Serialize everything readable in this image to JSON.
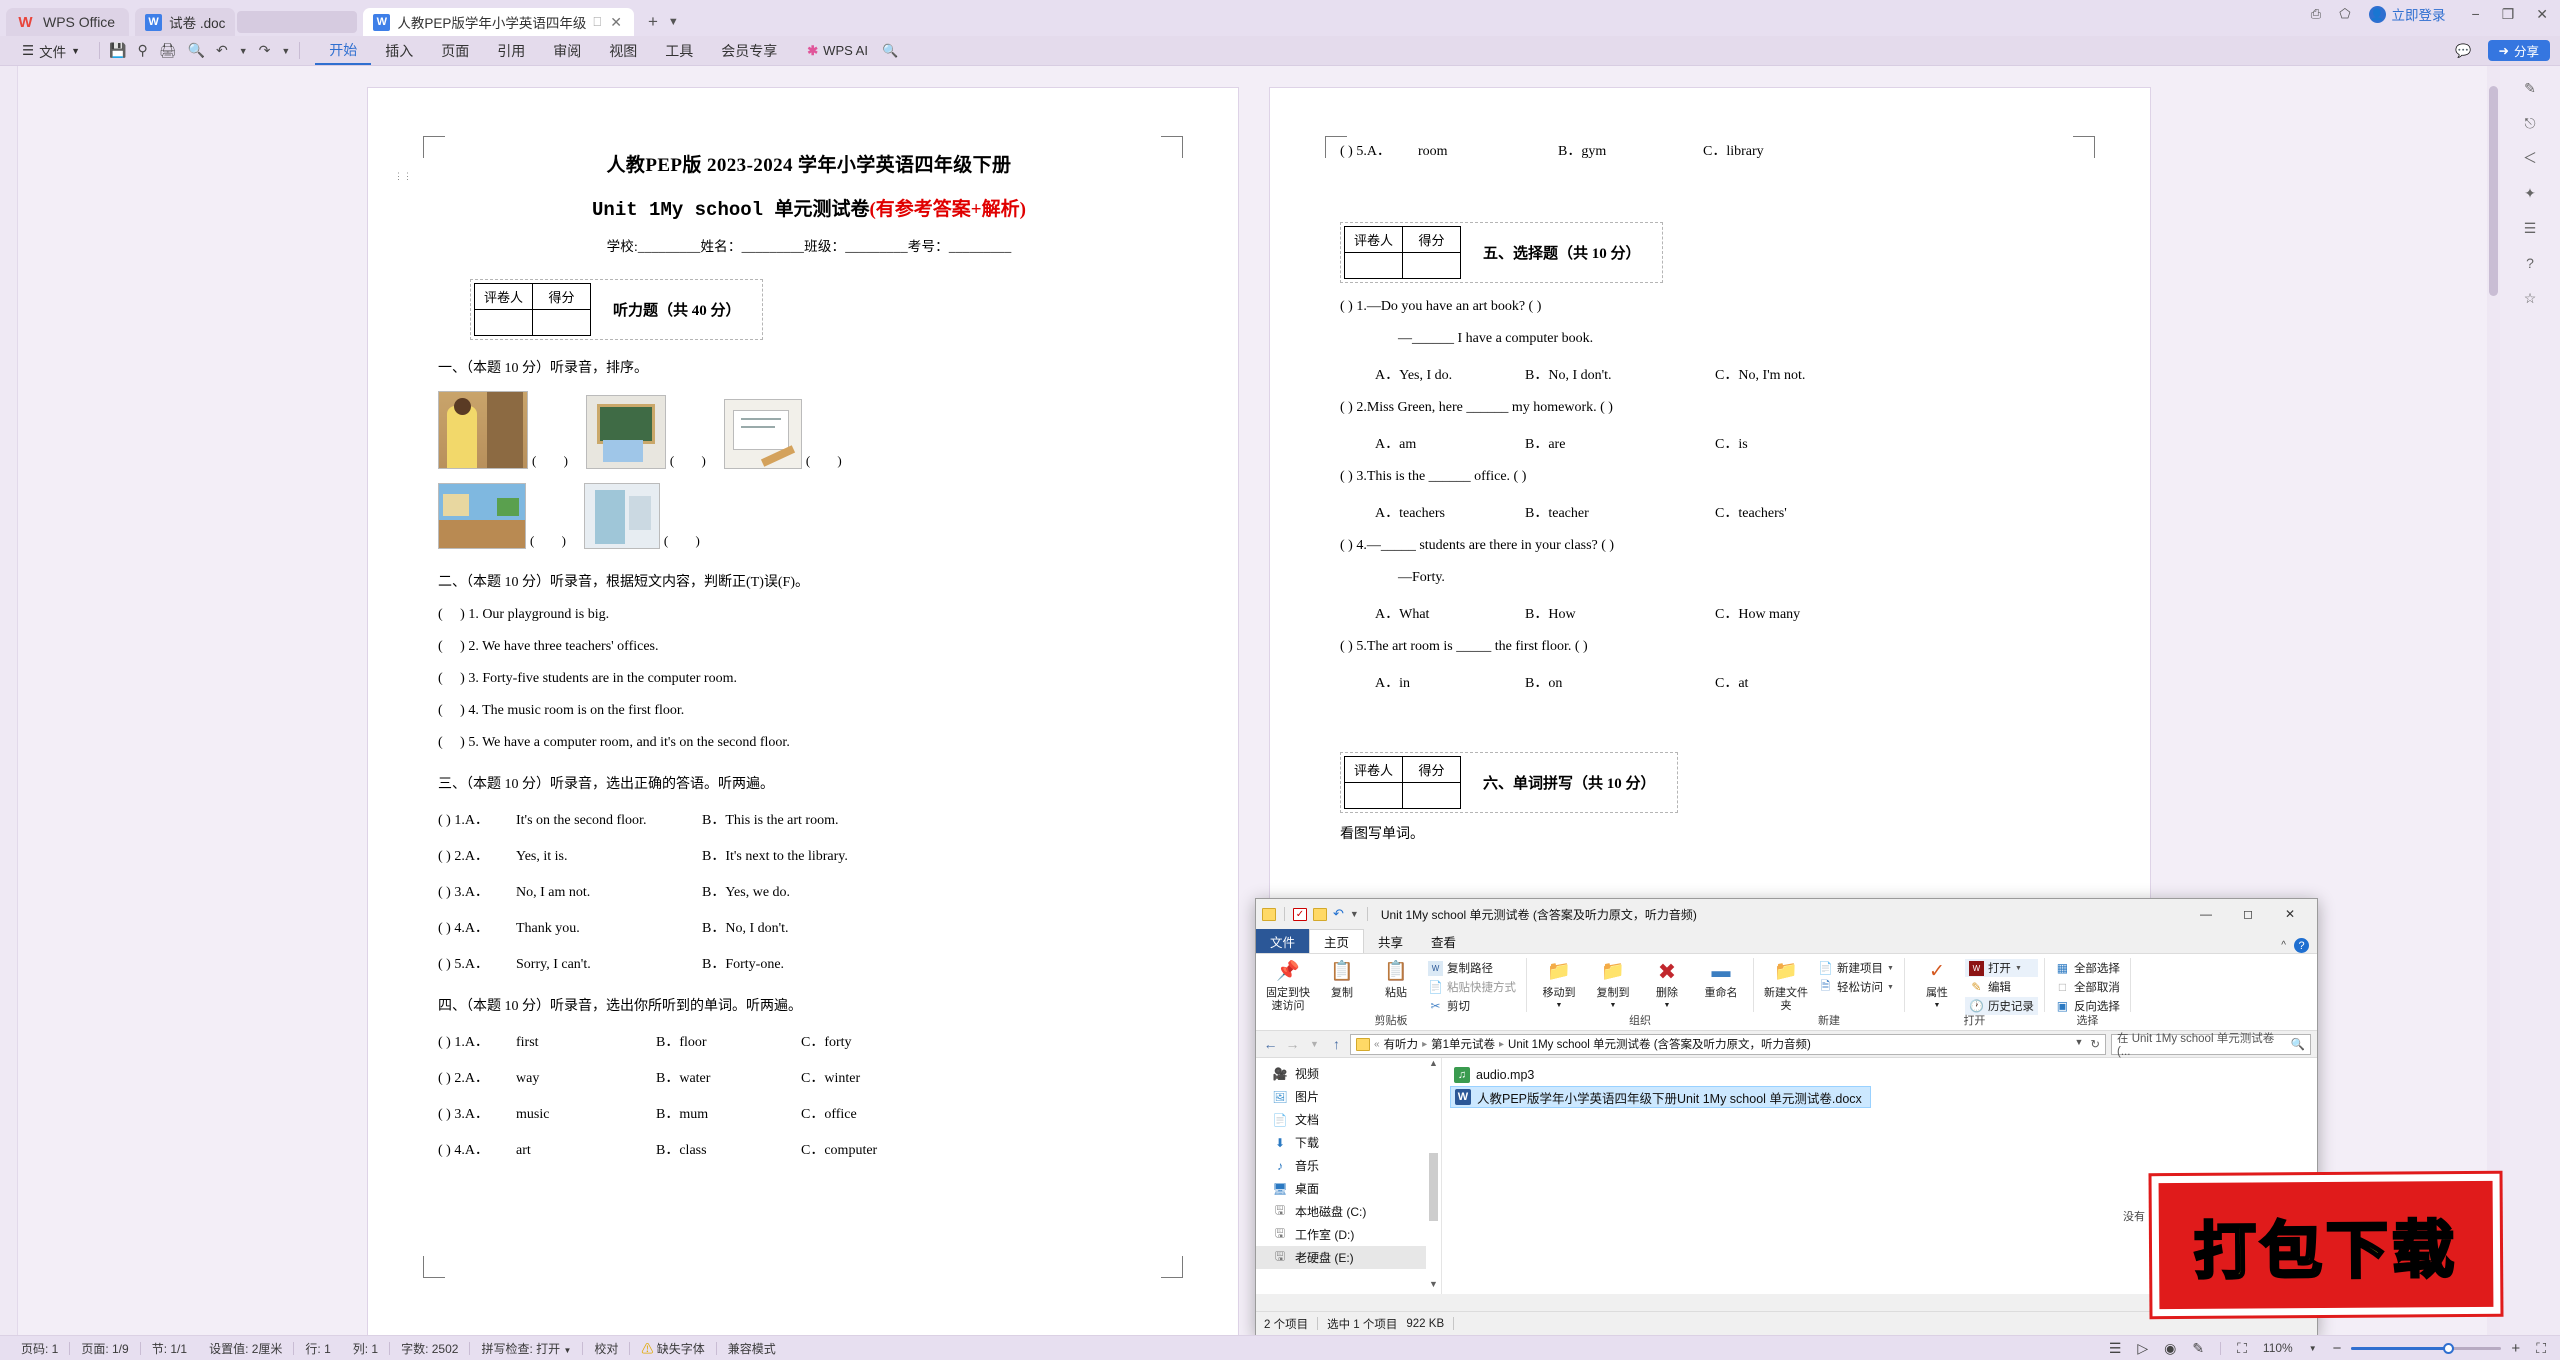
{
  "titlebar": {
    "app_label": "WPS Office",
    "app_icon": "wps-logo-icon",
    "tabs": [
      {
        "label": "试卷 .doc",
        "icon": "word-doc-icon",
        "active": false
      },
      {
        "label": "人教PEP版学年小学英语四年级",
        "icon": "word-doc-icon",
        "active": true
      }
    ],
    "new_tab": "+",
    "login_label": "立即登录",
    "share_label": "分享",
    "minimize": "−",
    "restore": "❐",
    "close": "✕"
  },
  "ribbon": {
    "file_menu": "文件",
    "quick_icons": [
      "save-icon",
      "print-preview-icon",
      "print-icon",
      "find-print-icon",
      "undo-icon",
      "redo-icon"
    ],
    "menu": [
      {
        "label": "开始",
        "active": true
      },
      {
        "label": "插入",
        "active": false
      },
      {
        "label": "页面",
        "active": false
      },
      {
        "label": "引用",
        "active": false
      },
      {
        "label": "审阅",
        "active": false
      },
      {
        "label": "视图",
        "active": false
      },
      {
        "label": "工具",
        "active": false
      },
      {
        "label": "会员专享",
        "active": false
      }
    ],
    "ai_label": "WPS AI",
    "search_icon": "search-icon"
  },
  "document": {
    "title_line1": "人教PEP版 2023-2024 学年小学英语四年级下册",
    "title_line2_black": "Unit 1My school 单元测试卷",
    "title_line2_red": "(有参考答案+解析)",
    "meta_line": "学校:_________姓名：_________班级：_________考号：_________",
    "score_table": {
      "grader": "评卷人",
      "score": "得分"
    },
    "section_listening": "听力题（共 40 分）",
    "q1_head": "一、（本题 10 分）听录音，排序。",
    "q1_blanks": [
      "(        )",
      "(        )",
      "(        )",
      "(        )",
      "(        )"
    ],
    "q2_head": "二、（本题 10 分）听录音，根据短文内容，判断正(T)误(F)。",
    "q2_items": [
      "(     ) 1. Our playground is big.",
      "(     ) 2. We have three teachers' offices.",
      "(     ) 3. Forty-five students are in the computer room.",
      "(     ) 4. The music room is on the first floor.",
      "(     ) 5. We have a computer room, and it's on the second floor."
    ],
    "q3_head": "三、（本题 10 分）听录音，选出正确的答语。听两遍。",
    "q3_items": [
      {
        "num": "(      ) 1.A．",
        "a": "It's on the second floor.",
        "b": "B．This is the art room."
      },
      {
        "num": "(      ) 2.A．",
        "a": "Yes, it is.",
        "b": "B．It's next to the library."
      },
      {
        "num": "(      ) 3.A．",
        "a": "No, I am not.",
        "b": "B．Yes, we do."
      },
      {
        "num": "(      ) 4.A．",
        "a": "Thank you.",
        "b": "B．No, I don't."
      },
      {
        "num": "(      ) 5.A．",
        "a": "Sorry, I can't.",
        "b": "B．Forty-one."
      }
    ],
    "q4_head": "四、（本题 10 分）听录音，选出你所听到的单词。听两遍。",
    "q4_items": [
      {
        "num": "(      ) 1.A．",
        "a": "first",
        "b": "B．floor",
        "c": "C．forty"
      },
      {
        "num": "(      ) 2.A．",
        "a": "way",
        "b": "B．water",
        "c": "C．winter"
      },
      {
        "num": "(      ) 3.A．",
        "a": "music",
        "b": "B．mum",
        "c": "C．office"
      },
      {
        "num": "(      ) 4.A．",
        "a": "art",
        "b": "B．class",
        "c": "C．computer"
      },
      {
        "num": "(      ) 5.A．",
        "a": "room",
        "b": "B．gym",
        "c": "C．library"
      }
    ],
    "section_choice": "五、选择题（共 10 分）",
    "q5_items": [
      {
        "stem": "(     ) 1.—Do you have an art book? (    )",
        "sub": "—______ I have a computer book.",
        "a": "A．Yes, I do.",
        "b": "B．No, I don't.",
        "c": "C．No, I'm not."
      },
      {
        "stem": "(     ) 2.Miss Green, here ______ my homework. (   )",
        "sub": "",
        "a": "A．am",
        "b": "B．are",
        "c": "C．is"
      },
      {
        "stem": "(     ) 3.This is the ______ office. (   )",
        "sub": "",
        "a": "A．teachers",
        "b": "B．teacher",
        "c": "C．teachers'"
      },
      {
        "stem": "(     ) 4.—_____ students are there in your class? (   )",
        "sub": "—Forty.",
        "a": "A．What",
        "b": "B．How",
        "c": "C．How many"
      },
      {
        "stem": "(     ) 5.The art room is _____ the first floor. (   )",
        "sub": "",
        "a": "A．in",
        "b": "B．on",
        "c": "C．at"
      }
    ],
    "section_spelling": "六、单词拼写（共 10 分）",
    "q6_head": "看图写单词。"
  },
  "explorer": {
    "window_title": "Unit 1My school 单元测试卷 (含答案及听力原文，听力音频)",
    "quick_icons": [
      "folder-icon",
      "properties-icon",
      "new-folder-icon",
      "undo-icon",
      "customize-icon"
    ],
    "tabs": [
      "文件",
      "主页",
      "共享",
      "查看"
    ],
    "help_icon": "help-icon",
    "collapse_icon": "chevron-up-icon",
    "ribbon_groups": [
      {
        "name": "剪贴板",
        "big": [
          {
            "label": "固定到快速访问",
            "icon": "pin-icon"
          },
          {
            "label": "复制",
            "icon": "copy-icon"
          },
          {
            "label": "粘贴",
            "icon": "paste-icon"
          }
        ],
        "small": [
          {
            "label": "复制路径",
            "icon": "copy-path-icon"
          },
          {
            "label": "粘贴快捷方式",
            "icon": "paste-shortcut-icon"
          },
          {
            "label": "剪切",
            "icon": "scissors-icon"
          }
        ]
      },
      {
        "name": "组织",
        "big": [
          {
            "label": "移动到",
            "icon": "move-to-icon"
          },
          {
            "label": "复制到",
            "icon": "copy-to-icon"
          },
          {
            "label": "删除",
            "icon": "delete-icon"
          },
          {
            "label": "重命名",
            "icon": "rename-icon"
          }
        ],
        "small": []
      },
      {
        "name": "新建",
        "big": [
          {
            "label": "新建文件夹",
            "icon": "new-folder-icon"
          }
        ],
        "small": [
          {
            "label": "新建项目",
            "icon": "new-item-icon"
          },
          {
            "label": "轻松访问",
            "icon": "easy-access-icon"
          }
        ]
      },
      {
        "name": "打开",
        "big": [
          {
            "label": "属性",
            "icon": "properties-icon"
          }
        ],
        "small": [
          {
            "label": "打开",
            "icon": "wps-open-icon"
          },
          {
            "label": "编辑",
            "icon": "edit-icon"
          },
          {
            "label": "历史记录",
            "icon": "history-icon"
          }
        ]
      },
      {
        "name": "选择",
        "big": [],
        "small": [
          {
            "label": "全部选择",
            "icon": "select-all-icon"
          },
          {
            "label": "全部取消",
            "icon": "select-none-icon"
          },
          {
            "label": "反向选择",
            "icon": "invert-selection-icon"
          }
        ]
      }
    ],
    "address": {
      "crumbs": [
        "有听力",
        "第1单元试卷",
        "Unit 1My school 单元测试卷 (含答案及听力原文，听力音频)"
      ],
      "refresh_icon": "refresh-icon",
      "dropdown_icon": "chevron-down-icon"
    },
    "search_placeholder": "在 Unit 1My school 单元测试卷 (...",
    "nav_items": [
      {
        "label": "视频",
        "icon": "video-icon"
      },
      {
        "label": "图片",
        "icon": "picture-icon"
      },
      {
        "label": "文档",
        "icon": "documents-icon"
      },
      {
        "label": "下载",
        "icon": "download-icon"
      },
      {
        "label": "音乐",
        "icon": "music-icon"
      },
      {
        "label": "桌面",
        "icon": "desktop-icon"
      },
      {
        "label": "本地磁盘 (C:)",
        "icon": "drive-icon"
      },
      {
        "label": "工作室 (D:)",
        "icon": "drive-icon"
      },
      {
        "label": "老硬盘 (E:)",
        "icon": "drive-icon"
      }
    ],
    "files": [
      {
        "name": "audio.mp3",
        "icon": "mp3-icon",
        "selected": false
      },
      {
        "name": "人教PEP版学年小学英语四年级下册Unit 1My school 单元测试卷.docx",
        "icon": "word-doc-icon",
        "selected": true
      }
    ],
    "status": {
      "count": "2 个项目",
      "selection": "选中 1 个项目",
      "size": "922 KB"
    }
  },
  "stamp": {
    "text": "打包下载",
    "note": "没有"
  },
  "statusbar": {
    "items": [
      "页码: 1",
      "页面: 1/9",
      "节: 1/1",
      "设置值: 2厘米",
      "行: 1",
      "列: 1",
      "字数: 2502",
      "拼写检查: 打开",
      "校对",
      "缺失字体",
      "兼容模式"
    ],
    "zoom": "110%",
    "view_icons": [
      "outline-view-icon",
      "play-icon",
      "web-view-icon",
      "highlight-icon",
      "fullscreen-view-icon"
    ],
    "minus": "−",
    "plus": "+",
    "expand_icon": "expand-icon"
  },
  "colors": {
    "accent": "#2f6fd0",
    "wps_purple": "#e7dff0",
    "stamp_red": "#e01b1b",
    "stamp_yellow": "#f6f125",
    "title_red": "#e00000"
  }
}
